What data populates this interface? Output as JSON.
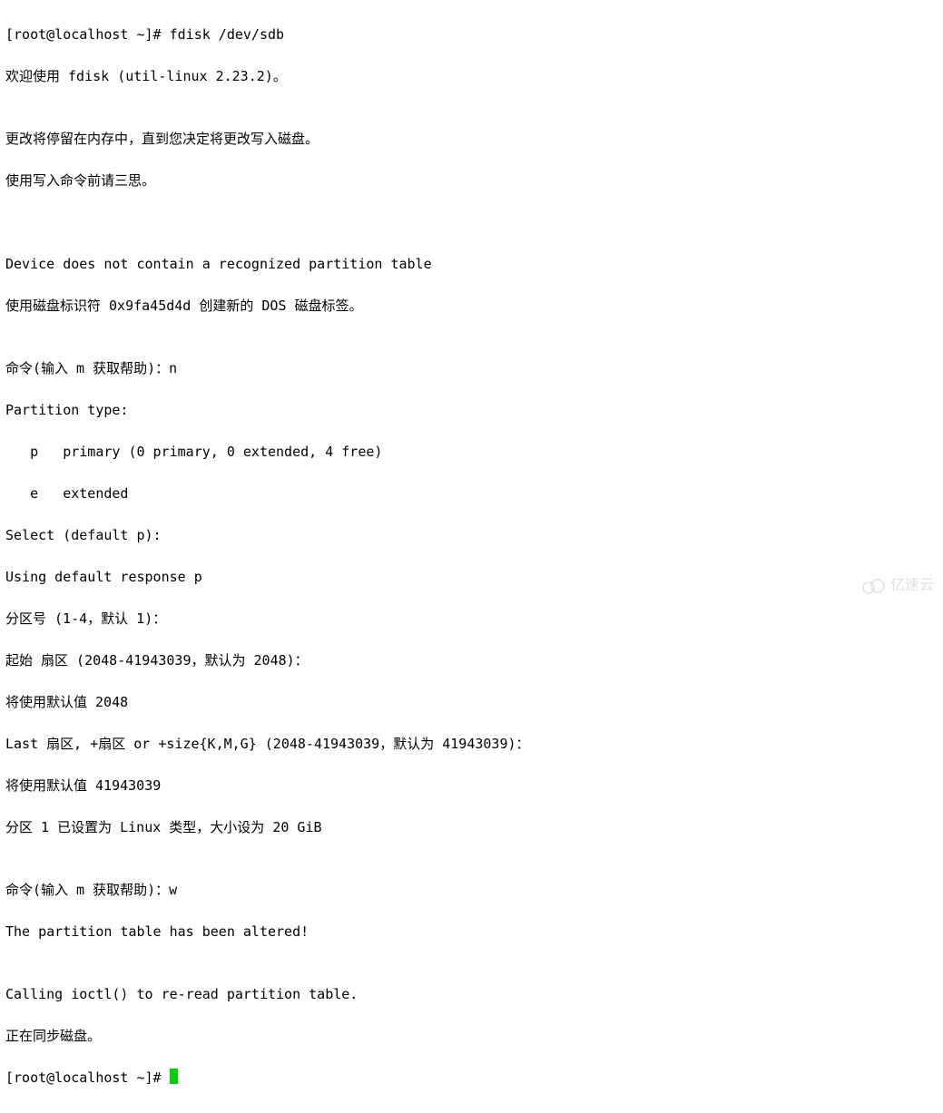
{
  "term": {
    "l01": "[root@localhost ~]# fdisk /dev/sdb",
    "l02": "欢迎使用 fdisk (util-linux 2.23.2)。",
    "l03": "",
    "l04": "更改将停留在内存中，直到您决定将更改写入磁盘。",
    "l05": "使用写入命令前请三思。",
    "l06": "",
    "l07": "",
    "l08": "Device does not contain a recognized partition table",
    "l09": "使用磁盘标识符 0x9fa45d4d 创建新的 DOS 磁盘标签。",
    "l10": "",
    "l11": "命令(输入 m 获取帮助)：n",
    "l12": "Partition type:",
    "l13": "   p   primary (0 primary, 0 extended, 4 free)",
    "l14": "   e   extended",
    "l15": "Select (default p):",
    "l16": "Using default response p",
    "l17": "分区号 (1-4，默认 1)：",
    "l18": "起始 扇区 (2048-41943039，默认为 2048)：",
    "l19": "将使用默认值 2048",
    "l20": "Last 扇区, +扇区 or +size{K,M,G} (2048-41943039，默认为 41943039)：",
    "l21": "将使用默认值 41943039",
    "l22": "分区 1 已设置为 Linux 类型，大小设为 20 GiB",
    "l23": "",
    "l24": "命令(输入 m 获取帮助)：w",
    "l25": "The partition table has been altered!",
    "l26": "",
    "l27": "Calling ioctl() to re-read partition table.",
    "l28": "正在同步磁盘。",
    "l29": "[root@localhost ~]# "
  },
  "watermark": {
    "text": "亿速云"
  }
}
